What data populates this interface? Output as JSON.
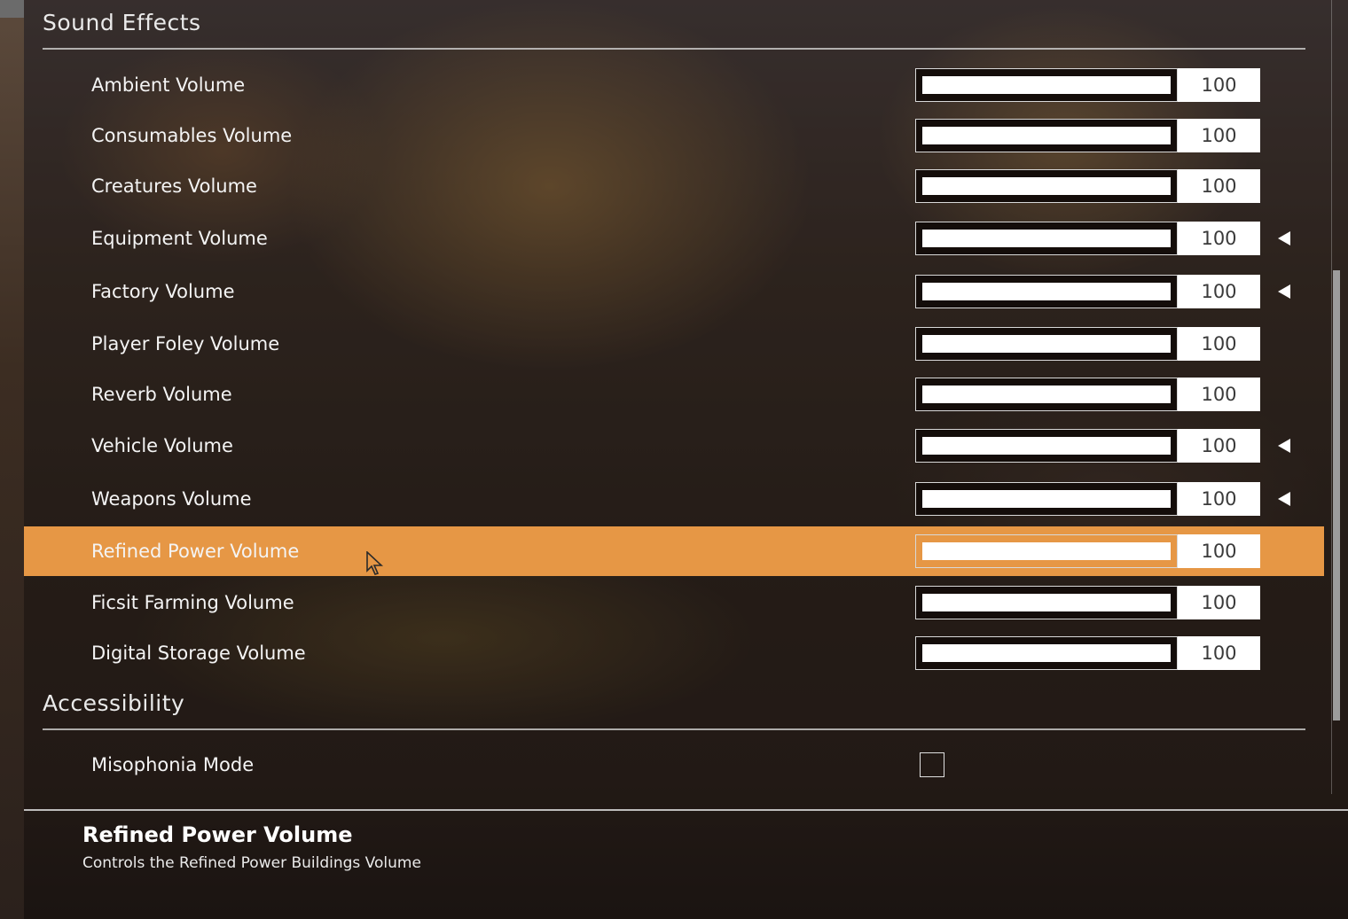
{
  "sections": {
    "sound_effects": {
      "title": "Sound Effects"
    },
    "accessibility": {
      "title": "Accessibility"
    }
  },
  "sound_settings": [
    {
      "label": "Ambient Volume",
      "value": "100",
      "level_percent": 100,
      "modified": false
    },
    {
      "label": "Consumables Volume",
      "value": "100",
      "level_percent": 100,
      "modified": false
    },
    {
      "label": "Creatures Volume",
      "value": "100",
      "level_percent": 100,
      "modified": false
    },
    {
      "label": "Equipment Volume",
      "value": "100",
      "level_percent": 100,
      "modified": true
    },
    {
      "label": "Factory Volume",
      "value": "100",
      "level_percent": 100,
      "modified": true
    },
    {
      "label": "Player Foley Volume",
      "value": "100",
      "level_percent": 100,
      "modified": false
    },
    {
      "label": "Reverb Volume",
      "value": "100",
      "level_percent": 100,
      "modified": false
    },
    {
      "label": "Vehicle Volume",
      "value": "100",
      "level_percent": 100,
      "modified": true
    },
    {
      "label": "Weapons Volume",
      "value": "100",
      "level_percent": 100,
      "modified": true
    },
    {
      "label": "Refined Power Volume",
      "value": "100",
      "level_percent": 100,
      "modified": false,
      "highlighted": true
    },
    {
      "label": "Ficsit Farming Volume",
      "value": "100",
      "level_percent": 100,
      "modified": false
    },
    {
      "label": "Digital Storage Volume",
      "value": "100",
      "level_percent": 100,
      "modified": false
    }
  ],
  "accessibility_settings": [
    {
      "label": "Misophonia Mode",
      "checked": false
    }
  ],
  "description": {
    "title": "Refined Power Volume",
    "text": "Controls the Refined Power Buildings Volume"
  },
  "colors": {
    "highlight": "#e69745",
    "slider_fill": "#ffffff",
    "value_box": "#ffffff"
  },
  "icons": {
    "modified_indicator": "reset-arrow-icon",
    "pointer": "mouse-cursor-icon"
  }
}
